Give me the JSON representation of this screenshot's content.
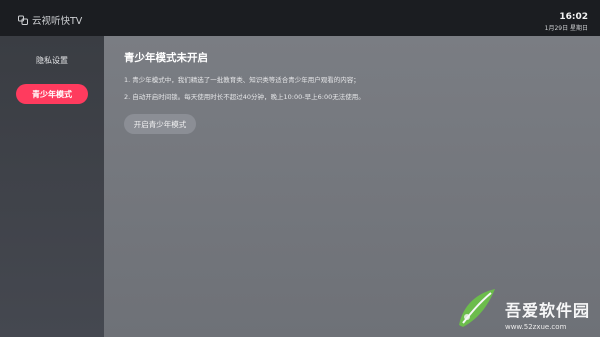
{
  "app": {
    "logo_text": "云视听快TV"
  },
  "status": {
    "time": "16:02",
    "date": "1月29日 星期日"
  },
  "sidebar": {
    "items": [
      {
        "label": "隐私设置",
        "active": false
      },
      {
        "label": "青少年模式",
        "active": true
      }
    ]
  },
  "main": {
    "title": "青少年模式未开启",
    "lines": [
      "1. 青少年模式中，我们精选了一批教育类、知识类等适合青少年用户观看的内容；",
      "2. 自动开启时间锁。每天使用时长不超过40分钟，晚上10:00-早上6:00无法使用。"
    ],
    "button_label": "开启青少年模式"
  },
  "watermark": {
    "name": "吾爱软件园",
    "url": "www.52zxue.com"
  }
}
